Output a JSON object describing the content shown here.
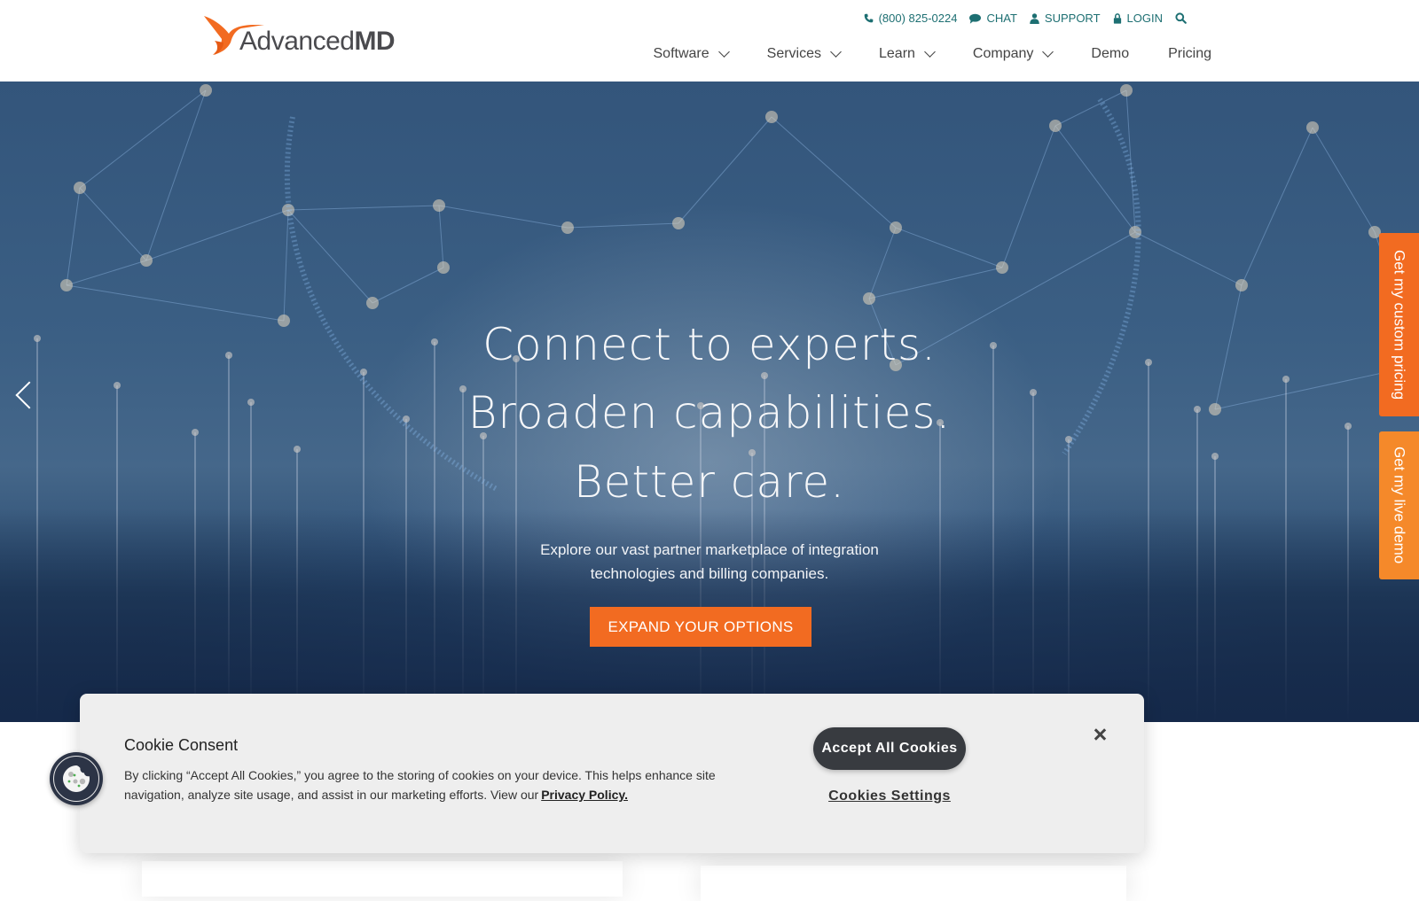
{
  "brand": {
    "name_light": "Advanced",
    "name_bold": "MD",
    "accent": "#f26b21",
    "accent_secondary": "#f5892a",
    "utility_color": "#1d6f72"
  },
  "utility_nav": {
    "phone": "(800) 825-0224",
    "chat": "CHAT",
    "support": "SUPPORT",
    "login": "LOGIN",
    "icons": [
      "phone-icon",
      "chat-icon",
      "user-icon",
      "lock-icon",
      "search-icon"
    ]
  },
  "main_nav": [
    {
      "label": "Software",
      "dropdown": true
    },
    {
      "label": "Services",
      "dropdown": true
    },
    {
      "label": "Learn",
      "dropdown": true
    },
    {
      "label": "Company",
      "dropdown": true
    },
    {
      "label": "Demo",
      "dropdown": false
    },
    {
      "label": "Pricing",
      "dropdown": false
    }
  ],
  "hero": {
    "headline_1": "Connect to experts.",
    "headline_2": "Broaden capabilities.",
    "headline_3": "Better care.",
    "subtext_1": "Explore our vast partner marketplace of integration",
    "subtext_2": "technologies and billing companies.",
    "cta": "EXPAND YOUR OPTIONS"
  },
  "side_tabs": {
    "pricing": "Get my custom pricing",
    "demo": "Get my live demo"
  },
  "cookie_banner": {
    "title": "Cookie Consent",
    "body": "By clicking “Accept All Cookies,” you agree to the storing of cookies on your device. This helps enhance site navigation, analyze site usage, and assist in our marketing efforts. View our",
    "privacy_link": "Privacy Policy.",
    "accept": "Accept All Cookies",
    "settings": "Cookies Settings"
  }
}
